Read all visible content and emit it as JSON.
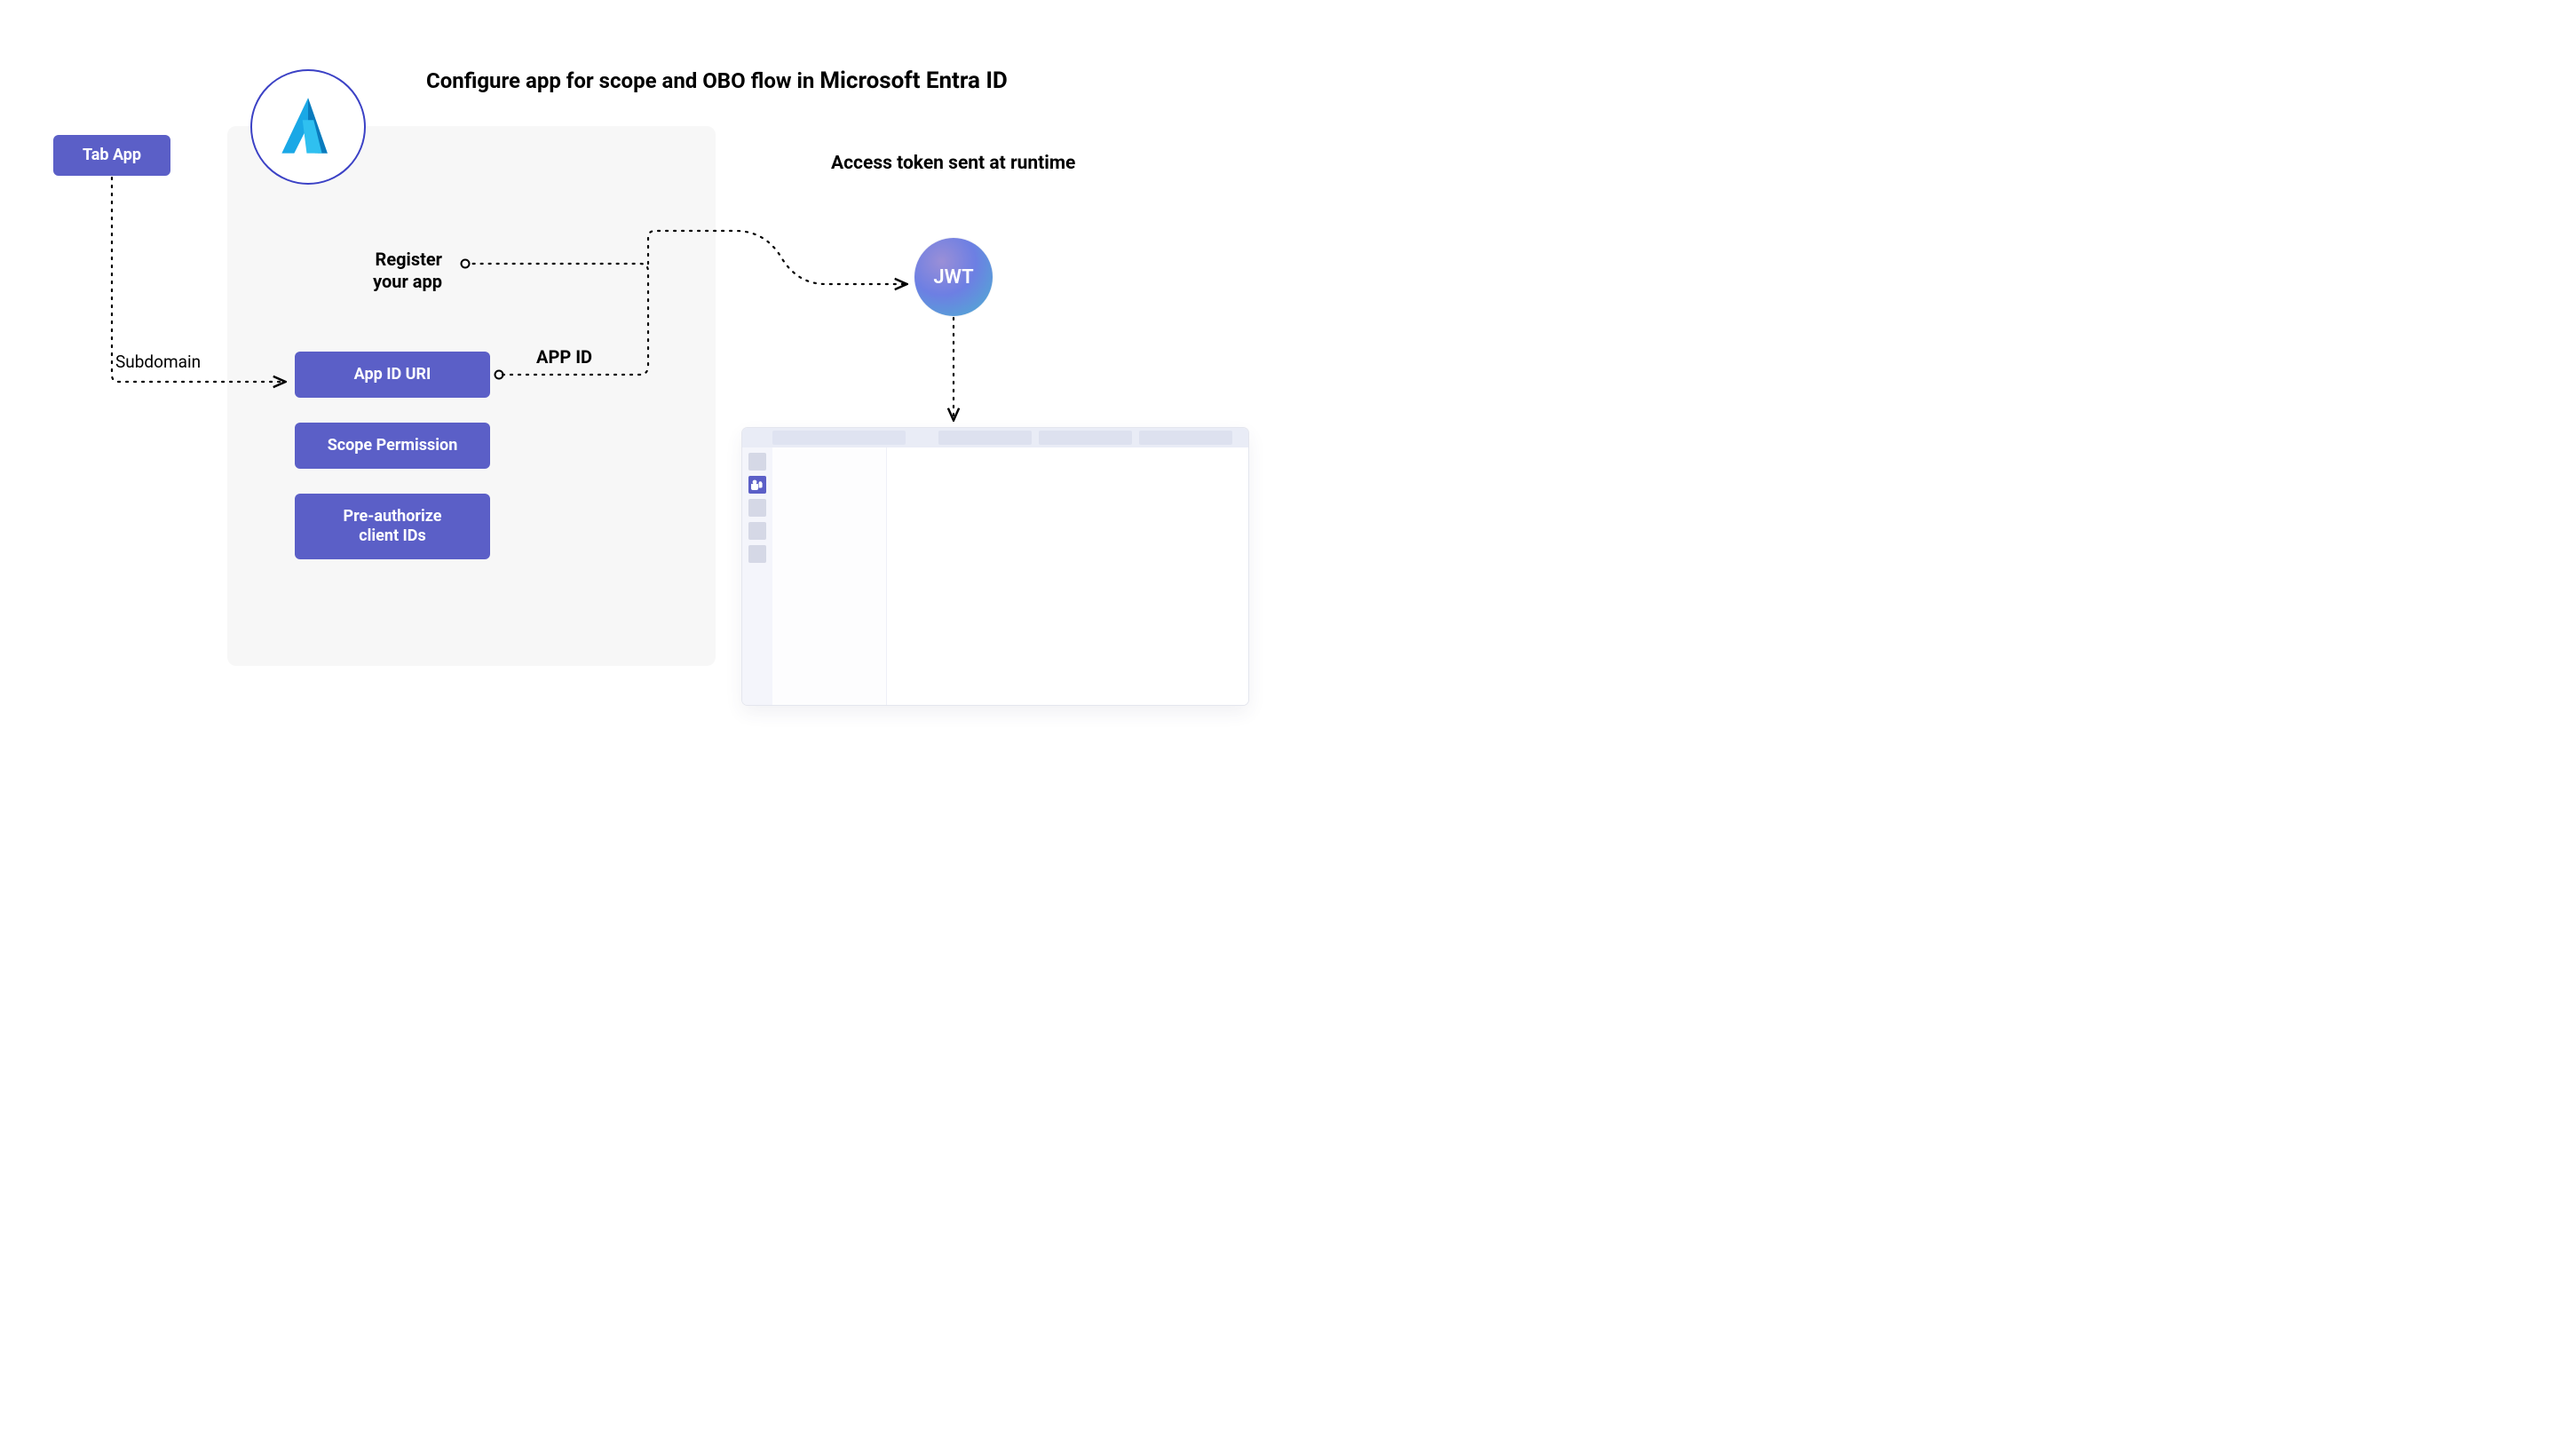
{
  "title": {
    "pre": "Configure app for scope and OBO flow in ",
    "strong": "Microsoft Entra ID"
  },
  "runtime_title": "Access token sent at runtime",
  "tab_app": "Tab App",
  "subdomain_label": "Subdomain",
  "register_line1": "Register",
  "register_line2": "your app",
  "app_id_uri": "App ID URI",
  "app_id_label": "APP ID",
  "scope_permission": "Scope Permission",
  "preauth_line1": "Pre-authorize",
  "preauth_line2": "client IDs",
  "jwt": "JWT",
  "colors": {
    "pill": "#5b5fc7",
    "panel": "#f7f7f7"
  }
}
